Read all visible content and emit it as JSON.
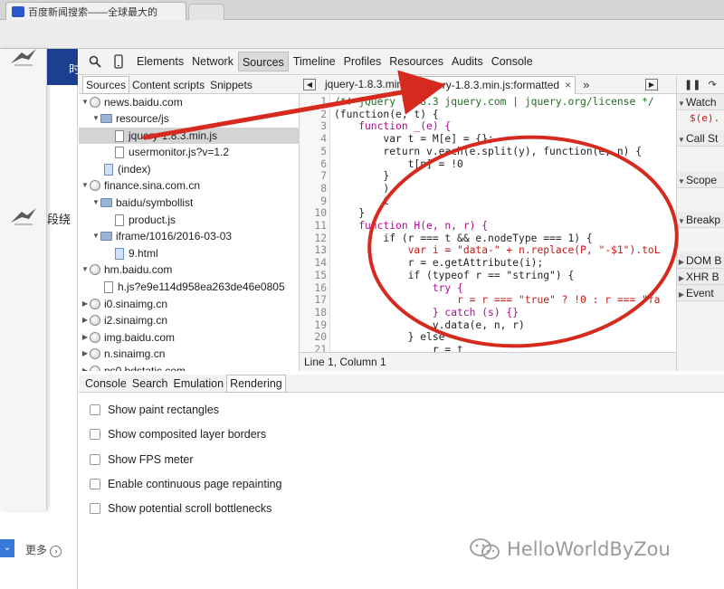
{
  "browser": {
    "tab_title": "百度新闻搜索——全球最大的"
  },
  "page": {
    "nav_char": "时",
    "cjk_text": "段绕",
    "more_label": "更多"
  },
  "devtools": {
    "tabs": [
      "Elements",
      "Network",
      "Sources",
      "Timeline",
      "Profiles",
      "Resources",
      "Audits",
      "Console"
    ],
    "active_tab": "Sources",
    "navigator_tabs": [
      "Sources",
      "Content scripts",
      "Snippets"
    ],
    "tree": [
      {
        "label": "news.baidu.com",
        "kind": "domain"
      },
      {
        "label": "resource/js",
        "kind": "folder"
      },
      {
        "label": "jquery-1.8.3.min.js",
        "kind": "file"
      },
      {
        "label": "usermonitor.js?v=1.2",
        "kind": "file"
      },
      {
        "label": "(index)",
        "kind": "file"
      },
      {
        "label": "finance.sina.com.cn",
        "kind": "domain"
      },
      {
        "label": "baidu/symbollist",
        "kind": "folder"
      },
      {
        "label": "product.js",
        "kind": "file"
      },
      {
        "label": "iframe/1016/2016-03-03",
        "kind": "folder"
      },
      {
        "label": "9.html",
        "kind": "file"
      },
      {
        "label": "hm.baidu.com",
        "kind": "domain"
      },
      {
        "label": "h.js?e9e114d958ea263de46e0805",
        "kind": "file"
      },
      {
        "label": "i0.sinaimg.cn",
        "kind": "domain"
      },
      {
        "label": "i2.sinaimg.cn",
        "kind": "domain"
      },
      {
        "label": "img.baidu.com",
        "kind": "domain"
      },
      {
        "label": "n.sinaimg.cn",
        "kind": "domain"
      },
      {
        "label": "ns0.bdstatic.com",
        "kind": "domain"
      }
    ],
    "editor_tabs": [
      "jquery-1.8.3.min.js",
      "jquery-1.8.3.min.js:formatted"
    ],
    "editor_close": "×",
    "editor_more": "»",
    "code_lines": [
      {
        "n": "1",
        "code": "/*! jQuery v1.8.3 jquery.com | jquery.org/license */"
      },
      {
        "n": "2",
        "code": "(function(e, t) {"
      },
      {
        "n": "3",
        "code": "    function _(e) {"
      },
      {
        "n": "4",
        "code": "        var t = M[e] = {};"
      },
      {
        "n": "5",
        "code": "        return v.each(e.split(y), function(e, n) {"
      },
      {
        "n": "6",
        "code": "            t[n] = !0"
      },
      {
        "n": "7",
        "code": "        }"
      },
      {
        "n": "8",
        "code": "        ),"
      },
      {
        "n": "9",
        "code": "        t"
      },
      {
        "n": "10",
        "code": "    }"
      },
      {
        "n": "11",
        "code": "    function H(e, n, r) {"
      },
      {
        "n": "12",
        "code": "        if (r === t && e.nodeType === 1) {"
      },
      {
        "n": "13",
        "code": "            var i = \"data-\" + n.replace(P, \"-$1\").toL"
      },
      {
        "n": "14",
        "code": "            r = e.getAttribute(i);"
      },
      {
        "n": "15",
        "code": "            if (typeof r == \"string\") {"
      },
      {
        "n": "16",
        "code": "                try {"
      },
      {
        "n": "17",
        "code": "                    r = r === \"true\" ? !0 : r === \"fa"
      },
      {
        "n": "18",
        "code": "                } catch (s) {}"
      },
      {
        "n": "19",
        "code": "                v.data(e, n, r)"
      },
      {
        "n": "20",
        "code": "            } else"
      },
      {
        "n": "21",
        "code": "                r = t"
      }
    ],
    "status": "Line 1, Column 1",
    "right_sections": [
      "Watch",
      "Call St",
      "Scope",
      "Breakp",
      "DOM B",
      "XHR B",
      "Event"
    ],
    "watch_sample": "$(e).",
    "drawer_tabs": [
      "Console",
      "Search",
      "Emulation",
      "Rendering"
    ],
    "active_drawer_tab": "Rendering",
    "rendering_options": [
      "Show paint rectangles",
      "Show composited layer borders",
      "Show FPS meter",
      "Enable continuous page repainting",
      "Show potential scroll bottlenecks"
    ]
  },
  "watermark": "HelloWorldByZou",
  "colors": {
    "annotation_red": "#d62a1f",
    "keyword": "#aa0d91",
    "string": "#c41a16",
    "comment": "#236e25"
  }
}
